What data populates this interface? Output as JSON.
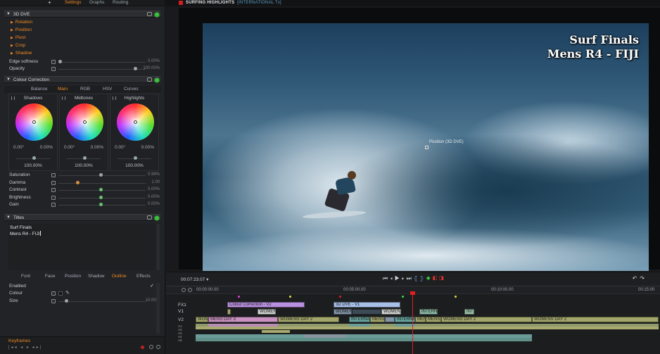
{
  "left": {
    "tabs": {
      "plus": "+",
      "settings": "Settings",
      "graphs": "Graphs",
      "routing": "Routing"
    },
    "dve": {
      "title": "3D DVE",
      "subsections": [
        "Rotation",
        "Position",
        "Pivot",
        "Crop",
        "Shadow"
      ],
      "edge_label": "Edge softness",
      "edge_value": "0.00%",
      "opacity_label": "Opacity",
      "opacity_value": "100.00%"
    },
    "cc": {
      "title": "Colour Correction",
      "tabs": [
        "Balance",
        "Main",
        "RGB",
        "HSV",
        "Curves"
      ],
      "wheels": [
        {
          "name": "Shadows",
          "a": "0.00°",
          "b": "0.00%",
          "pct": "100.00%"
        },
        {
          "name": "Midtones",
          "a": "0.00°",
          "b": "0.00%",
          "pct": "100.00%"
        },
        {
          "name": "Highlights",
          "a": "0.00°",
          "b": "0.00%",
          "pct": "100.00%"
        }
      ],
      "params": [
        {
          "label": "Saturation",
          "value": "0.98%",
          "knob": 0.48
        },
        {
          "label": "Gamma",
          "value": "1.00",
          "knob": 0.22
        },
        {
          "label": "Contrast",
          "value": "0.00%",
          "knob": 0.48
        },
        {
          "label": "Brightness",
          "value": "0.00%",
          "knob": 0.48
        },
        {
          "label": "Gain",
          "value": "0.00%",
          "knob": 0.48
        }
      ]
    },
    "titles": {
      "title": "Titles",
      "text_line1": "Surf Finals",
      "text_line2": "Mens R4 - FIJI",
      "tabs": [
        "Font",
        "Face",
        "Position",
        "Shadow",
        "Outline",
        "Effects"
      ],
      "enabled_label": "Enabled",
      "colour_label": "Colour",
      "size_label": "Size",
      "size_value": "10.00%"
    },
    "keyframes_label": "Keyframes",
    "keyframes_ctl": "|◂◂ ◂ ▸ ▸▸|"
  },
  "viewer": {
    "title": "SURFING HIGHLIGHTS",
    "title2": "[INTERNATIONAL Tx]",
    "overlay_line1": "Surf Finals",
    "overlay_line2": "Mens R4 - FIJI",
    "pos_label": "Position (3D DVE)",
    "timecode": "00:07:23.07",
    "timecode_arrow": "▾"
  },
  "timeline": {
    "ticks": [
      "00:00:00.00",
      "00:05:00.00",
      "00:10:00.00",
      "00:15:00"
    ],
    "tracks": [
      "FX1",
      "V1",
      "V2",
      "A1",
      "A2",
      "A3",
      "A4",
      "A5"
    ],
    "clips": {
      "cc": "Colour Correction - V2",
      "dve": "3D DVE - V1",
      "womens": "WOMEN",
      "womens2": "WOMENS",
      "intern": "INTERN",
      "int": "INT",
      "wom": "WOM",
      "mens_day3": "MENS DAY 3",
      "womens_day2a": "WOMENS DAY 2",
      "interna": "INTERNA",
      "mens": "MENS",
      "interna2": "INTERNA",
      "men": "MEN",
      "mens3": "MENS",
      "womens_day2b": "WOMENS DAY 2",
      "womens_day2c": "WOMENS DAY 2"
    }
  }
}
